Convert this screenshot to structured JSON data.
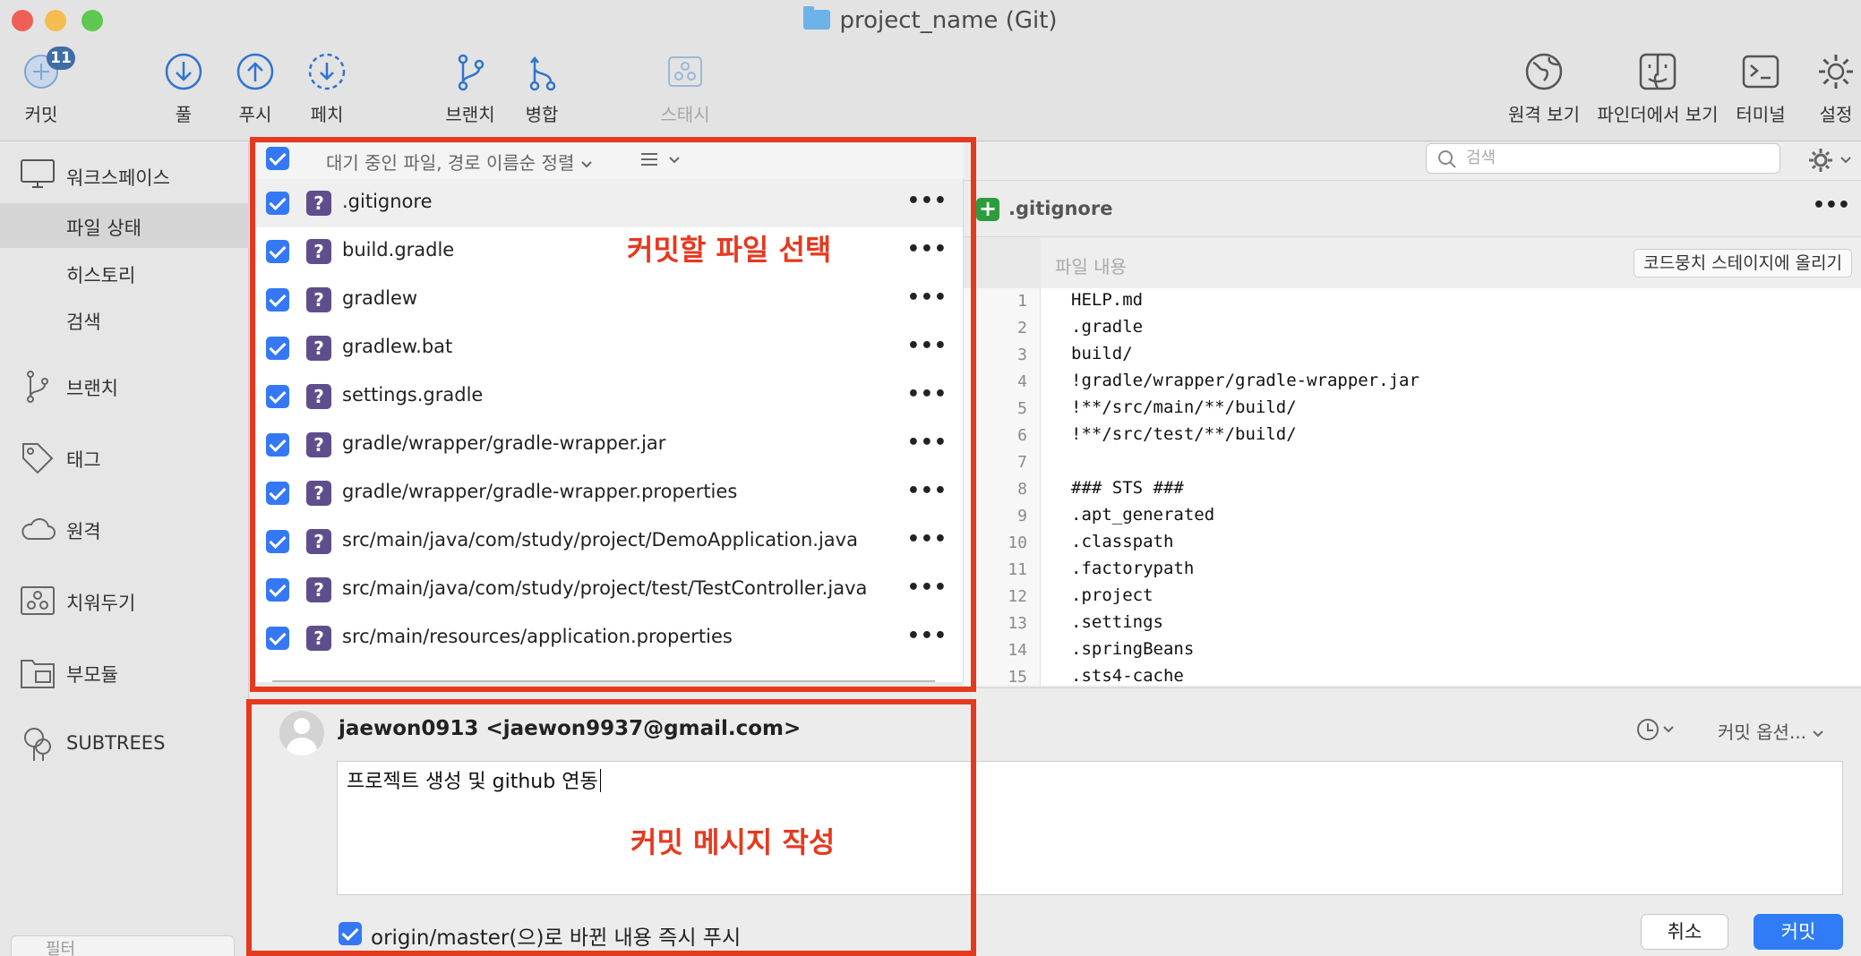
{
  "window": {
    "title": "project_name (Git)"
  },
  "toolbar": {
    "commit": {
      "label": "커밋",
      "badge": "11"
    },
    "pull": {
      "label": "풀"
    },
    "push": {
      "label": "푸시"
    },
    "fetch": {
      "label": "페치"
    },
    "branch": {
      "label": "브랜치"
    },
    "merge": {
      "label": "병합"
    },
    "stash": {
      "label": "스태시"
    },
    "remote_view": {
      "label": "원격 보기"
    },
    "finder_view": {
      "label": "파인더에서 보기"
    },
    "terminal": {
      "label": "터미널"
    },
    "settings": {
      "label": "설정"
    }
  },
  "sidebar": {
    "workspace": "워크스페이스",
    "file_status": "파일 상태",
    "history": "히스토리",
    "search": "검색",
    "branches": "브랜치",
    "tags": "태그",
    "remotes": "원격",
    "stashes": "치워두기",
    "submodules": "부모듈",
    "subtrees": "SUBTREES",
    "filter_placeholder": "필터"
  },
  "filelist": {
    "sort_label": "대기 중인 파일, 경로 이름순 정렬",
    "files": [
      ".gitignore",
      "build.gradle",
      "gradlew",
      "gradlew.bat",
      "settings.gradle",
      "gradle/wrapper/gradle-wrapper.jar",
      "gradle/wrapper/gradle-wrapper.properties",
      "src/main/java/com/study/project/DemoApplication.java",
      "src/main/java/com/study/project/test/TestController.java",
      "src/main/resources/application.properties"
    ],
    "status_glyph": "?",
    "more_glyph": "•••"
  },
  "diff": {
    "search_placeholder": "검색",
    "filename": ".gitignore",
    "more_glyph": "•••",
    "hunk_label": "파일 내용",
    "stage_button": "코드뭉치 스테이지에 올리기",
    "lines": [
      {
        "n": "1",
        "t": "HELP.md"
      },
      {
        "n": "2",
        "t": ".gradle"
      },
      {
        "n": "3",
        "t": "build/"
      },
      {
        "n": "4",
        "t": "!gradle/wrapper/gradle-wrapper.jar"
      },
      {
        "n": "5",
        "t": "!**/src/main/**/build/"
      },
      {
        "n": "6",
        "t": "!**/src/test/**/build/"
      },
      {
        "n": "7",
        "t": ""
      },
      {
        "n": "8",
        "t": "### STS ###"
      },
      {
        "n": "9",
        "t": ".apt_generated"
      },
      {
        "n": "10",
        "t": ".classpath"
      },
      {
        "n": "11",
        "t": ".factorypath"
      },
      {
        "n": "12",
        "t": ".project"
      },
      {
        "n": "13",
        "t": ".settings"
      },
      {
        "n": "14",
        "t": ".springBeans"
      },
      {
        "n": "15",
        "t": ".sts4-cache"
      }
    ]
  },
  "commit": {
    "author": "jaewon0913 <jaewon9937@gmail.com>",
    "message": "프로젝트 생성 및 github 연동",
    "options_label": "커밋 옵션...",
    "push_option": "origin/master(으)로 바뀐 내용 즉시 푸시",
    "cancel_label": "취소",
    "commit_label": "커밋"
  },
  "annotations": {
    "select_files": "커밋할 파일 선택",
    "write_message": "커밋 메시지 작성"
  },
  "colors": {
    "accent": "#3478f6",
    "annotation_red": "#e5391f",
    "untracked_purple": "#5f4e8c",
    "added_green": "#2d9c3d"
  }
}
